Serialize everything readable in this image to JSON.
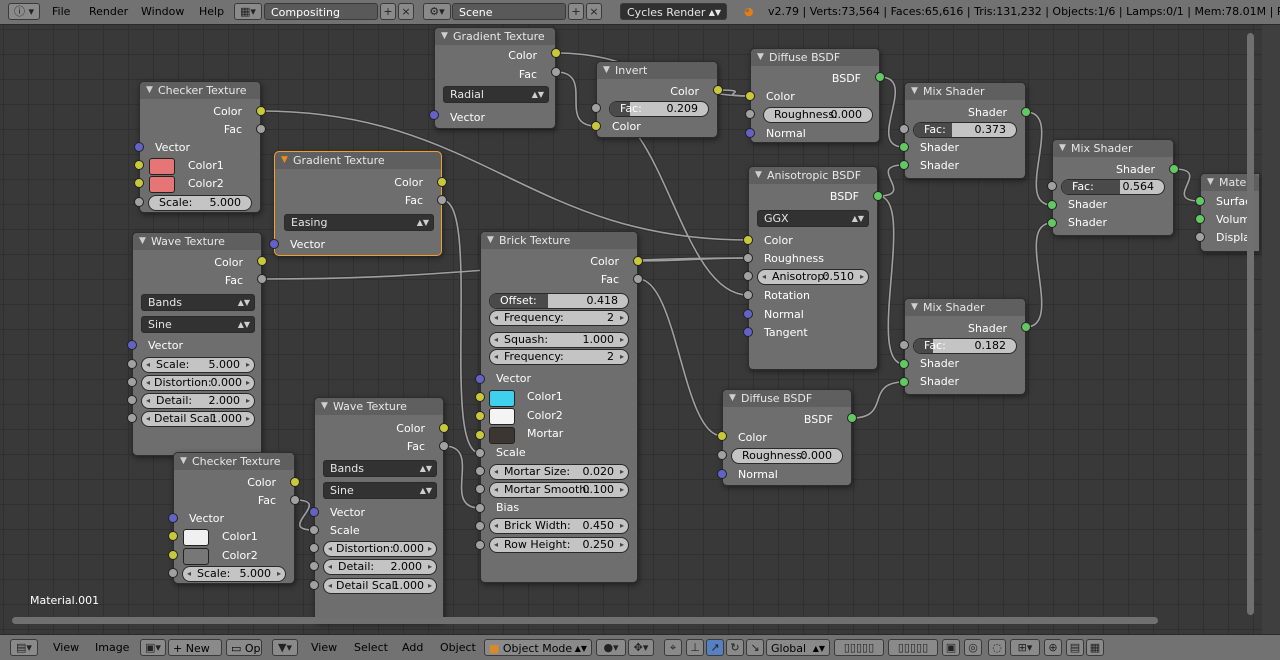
{
  "colors": {
    "color_socket": "#c8c83a",
    "value_socket": "#a1a1a1",
    "vector_socket": "#6363c7",
    "shader_socket": "#63c763",
    "selected_border": "#f0a030",
    "wire": "#9a9a9a"
  },
  "topbar": {
    "info_icon": "info-icon",
    "menu": {
      "file": "File",
      "render": "Render",
      "window": "Window",
      "help": "Help"
    },
    "screen_layout": "Compositing",
    "scene": "Scene",
    "render_engine": "Cycles Render",
    "stats": "v2.79 | Verts:73,564 | Faces:65,616 | Tris:131,232 | Objects:1/6 | Lamps:0/1 | Mem:78.01M | Plane"
  },
  "editor": {
    "material_name": "Material.001"
  },
  "nodes": {
    "grad1": {
      "title": "Gradient Texture",
      "out_color": "Color",
      "out_fac": "Fac",
      "type_value": "Radial",
      "in_vector": "Vector"
    },
    "invert": {
      "title": "Invert",
      "out_color": "Color",
      "fac_label": "Fac:",
      "fac_value": "0.209",
      "fac_fill": 0.209,
      "in_color": "Color"
    },
    "diff1": {
      "title": "Diffuse BSDF",
      "out_bsdf": "BSDF",
      "in_color": "Color",
      "rough_label": "Roughness:",
      "rough_value": "0.000",
      "in_normal": "Normal"
    },
    "mix1": {
      "title": "Mix Shader",
      "out_shader": "Shader",
      "fac_label": "Fac:",
      "fac_value": "0.373",
      "fac_fill": 0.373,
      "in_shader1": "Shader",
      "in_shader2": "Shader"
    },
    "mix2": {
      "title": "Mix Shader",
      "out_shader": "Shader",
      "fac_label": "Fac:",
      "fac_value": "0.564",
      "fac_fill": 0.564,
      "in_shader1": "Shader",
      "in_shader2": "Shader"
    },
    "matout": {
      "title": "Mate",
      "in_surface": "Surfac",
      "in_volume": "Volum",
      "in_displacement": "Displa"
    },
    "check1": {
      "title": "Checker Texture",
      "out_color": "Color",
      "out_fac": "Fac",
      "in_vector": "Vector",
      "color1_label": "Color1",
      "color1_swatch": "#e67676",
      "color2_label": "Color2",
      "color2_swatch": "#e67676",
      "scale_label": "Scale:",
      "scale_value": "5.000"
    },
    "grad2": {
      "title": "Gradient Texture",
      "out_color": "Color",
      "out_fac": "Fac",
      "type_value": "Easing",
      "in_vector": "Vector"
    },
    "aniso": {
      "title": "Anisotropic BSDF",
      "out_bsdf": "BSDF",
      "dist_value": "GGX",
      "in_color": "Color",
      "in_roughness": "Roughness",
      "aniso_label": "Anisotrop:",
      "aniso_value": "0.510",
      "in_rotation": "Rotation",
      "in_normal": "Normal",
      "in_tangent": "Tangent"
    },
    "wave1": {
      "title": "Wave Texture",
      "out_color": "Color",
      "out_fac": "Fac",
      "type_value": "Bands",
      "profile_value": "Sine",
      "in_vector": "Vector",
      "scale_label": "Scale:",
      "scale_value": "5.000",
      "distortion_label": "Distortion:",
      "distortion_value": "0.000",
      "detail_label": "Detail:",
      "detail_value": "2.000",
      "detail_scale_label": "Detail Scal:",
      "detail_scale_value": "1.000"
    },
    "brick": {
      "title": "Brick Texture",
      "out_color": "Color",
      "out_fac": "Fac",
      "offset_label": "Offset:",
      "offset_value": "0.418",
      "offset_fill": 0.418,
      "freq1_label": "Frequency:",
      "freq1_value": "2",
      "squash_label": "Squash:",
      "squash_value": "1.000",
      "freq2_label": "Frequency:",
      "freq2_value": "2",
      "in_vector": "Vector",
      "color1_label": "Color1",
      "color1_swatch": "#3fd0ee",
      "color2_label": "Color2",
      "color2_swatch": "#f4f4f4",
      "mortar_label": "Mortar",
      "mortar_swatch": "#3b3632",
      "in_scale": "Scale",
      "mortar_size_label": "Mortar Size:",
      "mortar_size_value": "0.020",
      "mortar_smooth_label": "Mortar Smooth:",
      "mortar_smooth_value": "0.100",
      "in_bias": "Bias",
      "brick_width_label": "Brick Width:",
      "brick_width_value": "0.450",
      "row_height_label": "Row Height:",
      "row_height_value": "0.250"
    },
    "mix3": {
      "title": "Mix Shader",
      "out_shader": "Shader",
      "fac_label": "Fac:",
      "fac_value": "0.182",
      "fac_fill": 0.182,
      "in_shader1": "Shader",
      "in_shader2": "Shader"
    },
    "diff2": {
      "title": "Diffuse BSDF",
      "out_bsdf": "BSDF",
      "in_color": "Color",
      "rough_label": "Roughness:",
      "rough_value": "0.000",
      "in_normal": "Normal"
    },
    "wave2": {
      "title": "Wave Texture",
      "out_color": "Color",
      "out_fac": "Fac",
      "type_value": "Bands",
      "profile_value": "Sine",
      "in_vector": "Vector",
      "in_scale": "Scale",
      "distortion_label": "Distortion:",
      "distortion_value": "0.000",
      "detail_label": "Detail:",
      "detail_value": "2.000",
      "detail_scale_label": "Detail Scal:",
      "detail_scale_value": "1.000"
    },
    "check2": {
      "title": "Checker Texture",
      "out_color": "Color",
      "out_fac": "Fac",
      "in_vector": "Vector",
      "color1_label": "Color1",
      "color1_swatch": "#f0f0f0",
      "color2_label": "Color2",
      "color2_swatch": "#777777",
      "scale_label": "Scale:",
      "scale_value": "5.000"
    }
  },
  "bottombar": {
    "view": "View",
    "image": "Image",
    "new": "New",
    "open": "Op",
    "view2": "View",
    "select": "Select",
    "add": "Add",
    "object": "Object",
    "mode": "Object Mode",
    "orientation": "Global"
  }
}
